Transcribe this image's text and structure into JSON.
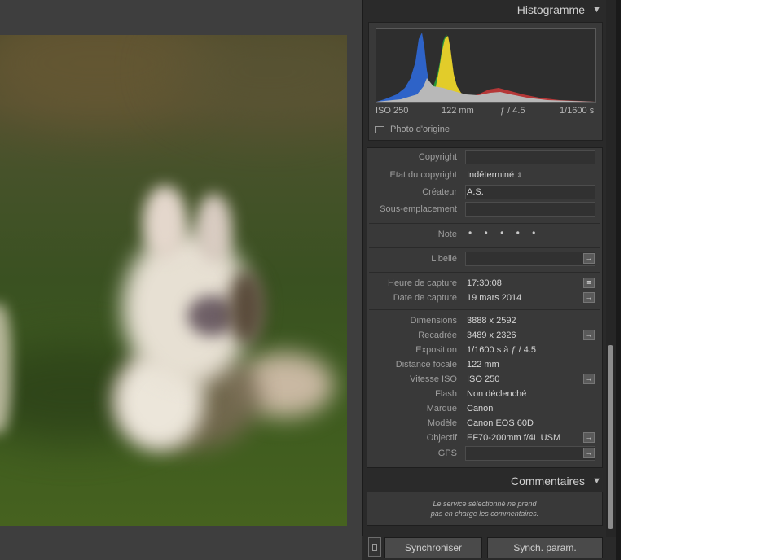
{
  "histogram": {
    "title": "Histogramme",
    "iso": "ISO 250",
    "focal": "122 mm",
    "aperture": "ƒ / 4.5",
    "shutter": "1/1600 s",
    "original_photo_label": "Photo d'origine"
  },
  "metadata": {
    "copyright_label": "Copyright",
    "copyright_value": "",
    "copyright_status_label": "Etat du copyright",
    "copyright_status_value": "Indéterminé",
    "creator_label": "Créateur",
    "creator_value": "A.S.",
    "sublocation_label": "Sous-emplacement",
    "sublocation_value": "",
    "rating_label": "Note",
    "rating_dots": "• • • • •",
    "label_label": "Libellé",
    "label_value": "",
    "capture_time_label": "Heure de capture",
    "capture_time_value": "17:30:08",
    "capture_date_label": "Date de capture",
    "capture_date_value": "19 mars 2014",
    "dimensions_label": "Dimensions",
    "dimensions_value": "3888 x 2592",
    "cropped_label": "Recadrée",
    "cropped_value": "3489 x 2326",
    "exposure_label": "Exposition",
    "exposure_value": "1/1600 s à ƒ / 4.5",
    "focal_label": "Distance focale",
    "focal_value": "122 mm",
    "iso_label": "Vitesse ISO",
    "iso_value": "ISO 250",
    "flash_label": "Flash",
    "flash_value": "Non déclenché",
    "make_label": "Marque",
    "make_value": "Canon",
    "model_label": "Modèle",
    "model_value": "Canon EOS 60D",
    "lens_label": "Objectif",
    "lens_value": "EF70-200mm f/4L USM",
    "gps_label": "GPS",
    "gps_value": ""
  },
  "comments": {
    "title": "Commentaires",
    "message_line1": "Le service sélectionné ne prend",
    "message_line2": "pas en charge les commentaires."
  },
  "footer": {
    "sync_label": "Synchroniser",
    "sync_settings_label": "Synch. param."
  },
  "icons": {
    "collapse": "▼",
    "arrow": "→",
    "list": "≡",
    "updown": "⇕"
  }
}
